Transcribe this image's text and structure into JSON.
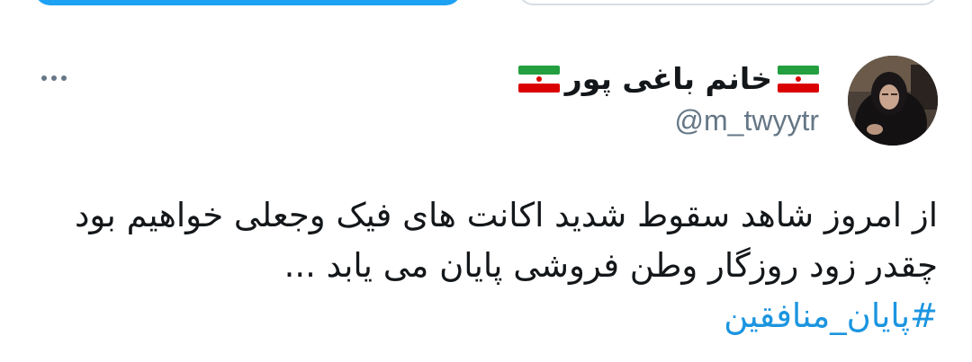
{
  "profile": {
    "display_name": "خانم باغی پور",
    "handle": "@m_twyytr",
    "flag_icon": "iran-flag-icon",
    "avatar_icon": "avatar-photo"
  },
  "tweet": {
    "lines": [
      "از امروز شاهد سقوط شدید اکانت های فیک وجعلی خواهیم بود",
      "چقدر زود روزگار وطن فروشی  پایان می یابد ..."
    ],
    "hashtag": "#پایان_منافقین"
  },
  "colors": {
    "accent": "#1da1f2",
    "hashtag": "#1b95e0",
    "text": "#14171a",
    "secondary": "#657786"
  }
}
